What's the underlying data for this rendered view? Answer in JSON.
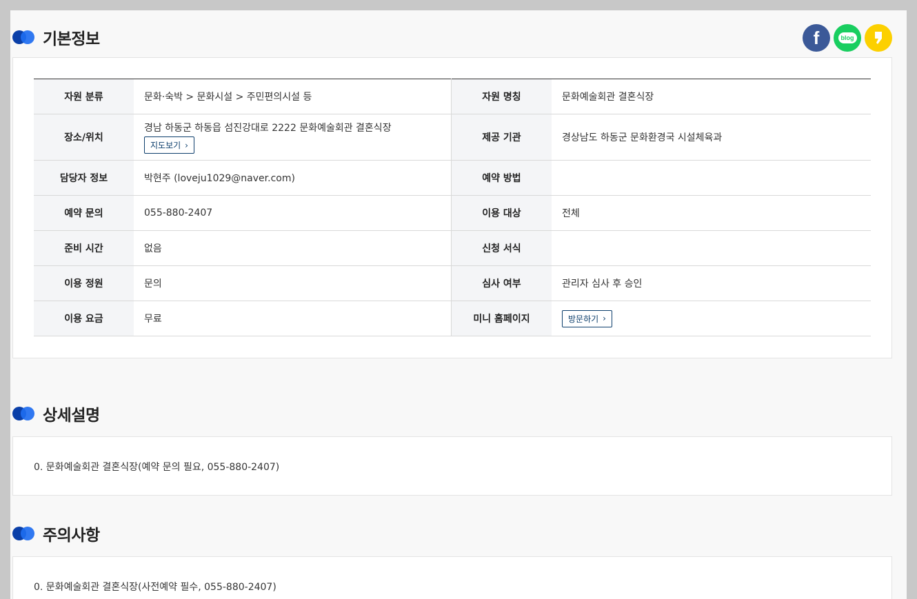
{
  "sections": {
    "basic_title": "기본정보",
    "detail_title": "상세설명",
    "notice_title": "주의사항"
  },
  "share": {
    "facebook_glyph": "f",
    "blog_glyph": "blog",
    "kakao_glyph": "❜"
  },
  "info": {
    "category_label": "자원 분류",
    "category_value": "문화·숙박 > 문화시설 > 주민편의시설 등",
    "name_label": "자원 명칭",
    "name_value": "문화예술회관 결혼식장",
    "location_label": "장소/위치",
    "location_value": "경남 하동군 하동읍 섬진강대로 2222 문화예술회관 결혼식장",
    "map_button": "지도보기",
    "provider_label": "제공 기관",
    "provider_value": "경상남도 하동군 문화환경국 시설체육과",
    "contact_label": "담당자 정보",
    "contact_value": "박현주  (loveju1029@naver.com)",
    "reserve_method_label": "예약 방법",
    "reserve_method_value": "",
    "reserve_inquiry_label": "예약 문의",
    "reserve_inquiry_value": "055-880-2407",
    "target_label": "이용 대상",
    "target_value": "전체",
    "prep_label": "준비 시간",
    "prep_value": "없음",
    "form_label": "신청 서식",
    "form_value": "",
    "capacity_label": "이용 정원",
    "capacity_value": "문의",
    "review_label": "심사 여부",
    "review_value": "관리자 심사 후 승인",
    "fee_label": "이용 요금",
    "fee_value": "무료",
    "homepage_label": "미니 홈페이지",
    "visit_button": "방문하기"
  },
  "detail_text": "0. 문화예술회관 결혼식장(예약 문의 필요, 055-880-2407)",
  "notice_text": "0. 문화예술회관 결혼식장(사전예약 필수, 055-880-2407)",
  "colors": {
    "accent_dark": "#0a3fa8",
    "accent_light": "#1e6cf0",
    "facebook": "#3b5998",
    "blog": "#19ce60",
    "kakao": "#fcd000"
  }
}
